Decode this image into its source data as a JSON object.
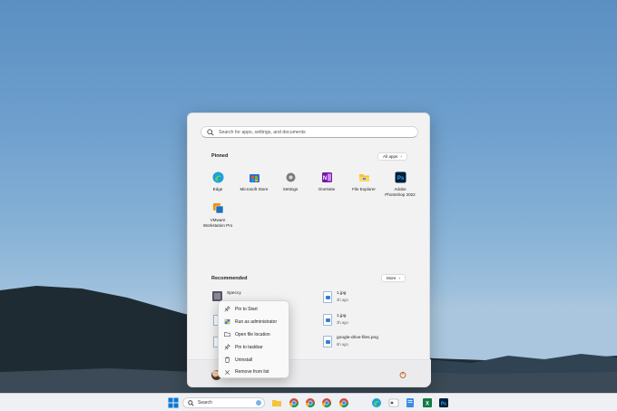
{
  "search": {
    "placeholder": "Search for apps, settings, and documents"
  },
  "pinned": {
    "title": "Pinned",
    "all_apps_label": "All apps",
    "apps": [
      {
        "label": "Edge",
        "icon": "edge-icon"
      },
      {
        "label": "Microsoft Store",
        "icon": "store-icon"
      },
      {
        "label": "Settings",
        "icon": "gear-icon"
      },
      {
        "label": "OneNote",
        "icon": "onenote-icon"
      },
      {
        "label": "File Explorer",
        "icon": "folder-icon"
      },
      {
        "label": "Adobe\nPhotoshop 2022",
        "icon": "photoshop-icon"
      },
      {
        "label": "VMware\nWorkstation Pro",
        "icon": "vmware-icon"
      }
    ]
  },
  "recommended": {
    "title": "Recommended",
    "more_label": "More",
    "items": [
      {
        "name": "Speccy",
        "sub": ""
      },
      {
        "name": "1.jpg",
        "sub": "3h ago"
      },
      {
        "name": "1.jpg",
        "sub": "3h ago"
      },
      {
        "name": "google-drive-files.png",
        "sub": "6h ago"
      }
    ]
  },
  "context_menu": [
    {
      "label": "Pin to Start",
      "icon": "pin-icon"
    },
    {
      "label": "Run as administrator",
      "icon": "shield-icon"
    },
    {
      "label": "Open file location",
      "icon": "folder-open-icon"
    },
    {
      "label": "Pin to taskbar",
      "icon": "pin-icon"
    },
    {
      "label": "Uninstall",
      "icon": "trash-icon"
    },
    {
      "label": "Remove from list",
      "icon": "close-icon"
    }
  ],
  "taskbar": {
    "search_label": "Search"
  },
  "colors": {
    "accent": "#0067c0",
    "edge": "#1da1d6",
    "onenote": "#7719aa",
    "photoshop": "#001e36",
    "folder": "#f5c23b"
  }
}
